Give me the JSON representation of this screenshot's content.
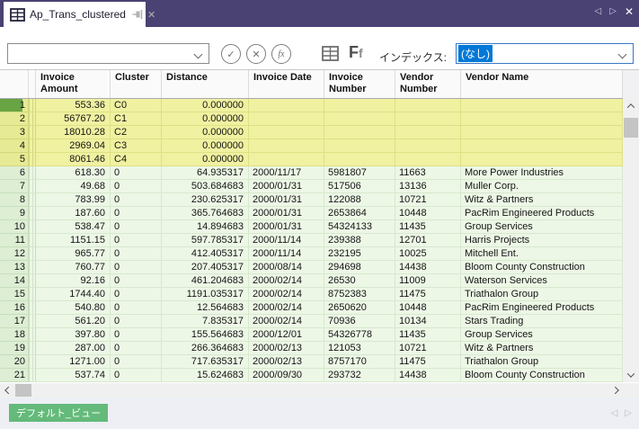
{
  "titlebar": {
    "tab_label": "Ap_Trans_clustered"
  },
  "icons": {
    "back_arrow": "◁",
    "forward_arrow": "▷",
    "close": "✕",
    "tab_close": "✕",
    "check": "✓",
    "cancel": "✕",
    "fx": "fx",
    "ff_big": "F",
    "ff_small": "f"
  },
  "toolbar": {
    "formula_combo_value": "",
    "index_label": "インデックス:",
    "index_value": "(なし)"
  },
  "colors": {
    "titlebar_purple": "#4a4273",
    "row_highlight_yellow": "#f0f1a1",
    "row_green": "#edf7e6",
    "current_record_marker": "#68a443",
    "view_tab_green": "#64ba7a",
    "selection_blue": "#0078d7"
  },
  "table": {
    "columns": [
      {
        "key": "amount",
        "label": "Invoice Amount",
        "align": "right"
      },
      {
        "key": "cluster",
        "label": "Cluster",
        "align": "left"
      },
      {
        "key": "distance",
        "label": "Distance",
        "align": "right"
      },
      {
        "key": "date",
        "label": "Invoice Date",
        "align": "left"
      },
      {
        "key": "invoice_number",
        "label": "Invoice Number",
        "align": "left"
      },
      {
        "key": "vendor_number",
        "label": "Vendor Number",
        "align": "left"
      },
      {
        "key": "vendor_name",
        "label": "Vendor Name",
        "align": "left"
      }
    ],
    "rows": [
      {
        "num": 1,
        "amount": "553.36",
        "cluster": "C0",
        "distance": "0.000000",
        "date": "",
        "invoice_number": "",
        "vendor_number": "",
        "vendor_name": "",
        "highlighted": true,
        "current": true
      },
      {
        "num": 2,
        "amount": "56767.20",
        "cluster": "C1",
        "distance": "0.000000",
        "date": "",
        "invoice_number": "",
        "vendor_number": "",
        "vendor_name": "",
        "highlighted": true,
        "current": false
      },
      {
        "num": 3,
        "amount": "18010.28",
        "cluster": "C2",
        "distance": "0.000000",
        "date": "",
        "invoice_number": "",
        "vendor_number": "",
        "vendor_name": "",
        "highlighted": true,
        "current": false
      },
      {
        "num": 4,
        "amount": "2969.04",
        "cluster": "C3",
        "distance": "0.000000",
        "date": "",
        "invoice_number": "",
        "vendor_number": "",
        "vendor_name": "",
        "highlighted": true,
        "current": false
      },
      {
        "num": 5,
        "amount": "8061.46",
        "cluster": "C4",
        "distance": "0.000000",
        "date": "",
        "invoice_number": "",
        "vendor_number": "",
        "vendor_name": "",
        "highlighted": true,
        "current": false
      },
      {
        "num": 6,
        "amount": "618.30",
        "cluster": "0",
        "distance": "64.935317",
        "date": "2000/11/17",
        "invoice_number": "5981807",
        "vendor_number": "11663",
        "vendor_name": "More Power Industries",
        "highlighted": false,
        "current": false
      },
      {
        "num": 7,
        "amount": "49.68",
        "cluster": "0",
        "distance": "503.684683",
        "date": "2000/01/31",
        "invoice_number": "517506",
        "vendor_number": "13136",
        "vendor_name": "Muller Corp.",
        "highlighted": false,
        "current": false
      },
      {
        "num": 8,
        "amount": "783.99",
        "cluster": "0",
        "distance": "230.625317",
        "date": "2000/01/31",
        "invoice_number": "122088",
        "vendor_number": "10721",
        "vendor_name": "Witz & Partners",
        "highlighted": false,
        "current": false
      },
      {
        "num": 9,
        "amount": "187.60",
        "cluster": "0",
        "distance": "365.764683",
        "date": "2000/01/31",
        "invoice_number": "2653864",
        "vendor_number": "10448",
        "vendor_name": "PacRim Engineered Products",
        "highlighted": false,
        "current": false
      },
      {
        "num": 10,
        "amount": "538.47",
        "cluster": "0",
        "distance": "14.894683",
        "date": "2000/01/31",
        "invoice_number": "54324133",
        "vendor_number": "11435",
        "vendor_name": "Group Services",
        "highlighted": false,
        "current": false
      },
      {
        "num": 11,
        "amount": "1151.15",
        "cluster": "0",
        "distance": "597.785317",
        "date": "2000/11/14",
        "invoice_number": "239388",
        "vendor_number": "12701",
        "vendor_name": "Harris Projects",
        "highlighted": false,
        "current": false
      },
      {
        "num": 12,
        "amount": "965.77",
        "cluster": "0",
        "distance": "412.405317",
        "date": "2000/11/14",
        "invoice_number": "232195",
        "vendor_number": "10025",
        "vendor_name": "Mitchell Ent.",
        "highlighted": false,
        "current": false
      },
      {
        "num": 13,
        "amount": "760.77",
        "cluster": "0",
        "distance": "207.405317",
        "date": "2000/08/14",
        "invoice_number": "294698",
        "vendor_number": "14438",
        "vendor_name": "Bloom County Construction",
        "highlighted": false,
        "current": false
      },
      {
        "num": 14,
        "amount": "92.16",
        "cluster": "0",
        "distance": "461.204683",
        "date": "2000/02/14",
        "invoice_number": "26530",
        "vendor_number": "11009",
        "vendor_name": "Waterson Services",
        "highlighted": false,
        "current": false
      },
      {
        "num": 15,
        "amount": "1744.40",
        "cluster": "0",
        "distance": "1191.035317",
        "date": "2000/02/14",
        "invoice_number": "8752383",
        "vendor_number": "11475",
        "vendor_name": "Triathalon Group",
        "highlighted": false,
        "current": false
      },
      {
        "num": 16,
        "amount": "540.80",
        "cluster": "0",
        "distance": "12.564683",
        "date": "2000/02/14",
        "invoice_number": "2650620",
        "vendor_number": "10448",
        "vendor_name": "PacRim Engineered Products",
        "highlighted": false,
        "current": false
      },
      {
        "num": 17,
        "amount": "561.20",
        "cluster": "0",
        "distance": "7.835317",
        "date": "2000/02/14",
        "invoice_number": "70936",
        "vendor_number": "10134",
        "vendor_name": "Stars Trading",
        "highlighted": false,
        "current": false
      },
      {
        "num": 18,
        "amount": "397.80",
        "cluster": "0",
        "distance": "155.564683",
        "date": "2000/12/01",
        "invoice_number": "54326778",
        "vendor_number": "11435",
        "vendor_name": "Group Services",
        "highlighted": false,
        "current": false
      },
      {
        "num": 19,
        "amount": "287.00",
        "cluster": "0",
        "distance": "266.364683",
        "date": "2000/02/13",
        "invoice_number": "121053",
        "vendor_number": "10721",
        "vendor_name": "Witz & Partners",
        "highlighted": false,
        "current": false
      },
      {
        "num": 20,
        "amount": "1271.00",
        "cluster": "0",
        "distance": "717.635317",
        "date": "2000/02/13",
        "invoice_number": "8757170",
        "vendor_number": "11475",
        "vendor_name": "Triathalon Group",
        "highlighted": false,
        "current": false
      },
      {
        "num": 21,
        "amount": "537.74",
        "cluster": "0",
        "distance": "15.624683",
        "date": "2000/09/30",
        "invoice_number": "293732",
        "vendor_number": "14438",
        "vendor_name": "Bloom County Construction",
        "highlighted": false,
        "current": false
      }
    ]
  },
  "statusbar": {
    "view_tab": "デフォルト_ビュー"
  }
}
